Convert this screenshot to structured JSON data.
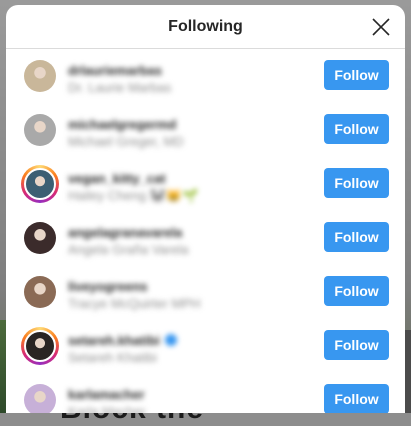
{
  "modal": {
    "title": "Following"
  },
  "users": [
    {
      "username": "drlauriemarbas",
      "full_name": "Dr. Laurie Marbas",
      "follow_label": "Follow",
      "verified": false,
      "has_story_ring": false,
      "avatar_color": "#c9b79a"
    },
    {
      "username": "michaelgregermd",
      "full_name": "Michael Greger, MD",
      "follow_label": "Follow",
      "verified": false,
      "has_story_ring": false,
      "avatar_color": "#a9a9a9"
    },
    {
      "username": "vegan_kitty_cat",
      "full_name": "Hailey Cheng 🐼😸🌱",
      "follow_label": "Follow",
      "verified": false,
      "has_story_ring": true,
      "avatar_color": "#3c5f73"
    },
    {
      "username": "angelagranavarela",
      "full_name": "Angela Graña Varela",
      "follow_label": "Follow",
      "verified": false,
      "has_story_ring": false,
      "avatar_color": "#3b2b2b"
    },
    {
      "username": "liveyogreens",
      "full_name": "Tracye McQuirter MPH",
      "follow_label": "Follow",
      "verified": false,
      "has_story_ring": false,
      "avatar_color": "#8a6a55"
    },
    {
      "username": "setareh.khatibi",
      "full_name": "Setareh Khatibi",
      "follow_label": "Follow",
      "verified": true,
      "has_story_ring": true,
      "avatar_color": "#2a2523"
    },
    {
      "username": "karlamacher",
      "full_name": "Karla Macher",
      "follow_label": "Follow",
      "verified": false,
      "has_story_ring": false,
      "avatar_color": "#c7b0d8"
    }
  ],
  "background": {
    "headline": "Block the"
  },
  "colors": {
    "accent": "#3897f0",
    "story_ring": "#d62976"
  },
  "icons": {
    "close": "close-icon",
    "verified": "verified-badge-icon"
  }
}
